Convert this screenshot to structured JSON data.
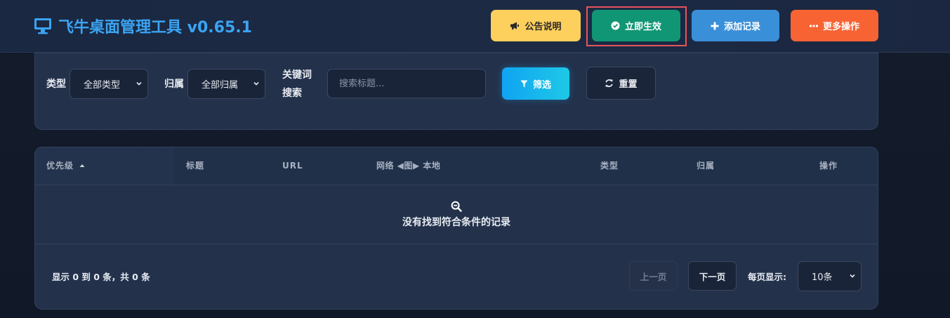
{
  "header": {
    "title": "飞牛桌面管理工具 v0.65.1",
    "buttons": {
      "notice": "公告说明",
      "apply": "立即生效",
      "add": "添加记录",
      "more": "更多操作"
    }
  },
  "filters": {
    "type_label": "类型",
    "type_value": "全部类型",
    "owner_label": "归属",
    "owner_value": "全部归属",
    "keyword_label_line1": "关键词",
    "keyword_label_line2": "搜索",
    "search_placeholder": "搜索标题...",
    "search_value": "",
    "filter_button": "筛选",
    "reset_button": "重置"
  },
  "table": {
    "columns": {
      "priority": "优先级",
      "title": "标题",
      "url": "URL",
      "network": "网络 ◀图▶ 本地",
      "type": "类型",
      "owner": "归属",
      "actions": "操作"
    },
    "sort_indicator": "up",
    "empty_message": "没有找到符合条件的记录"
  },
  "pagination": {
    "summary": "显示 0 到 0 条，共 0 条",
    "prev": "上一页",
    "next": "下一页",
    "per_page_label": "每页显示:",
    "per_page_value": "10条"
  },
  "colors": {
    "notice": "#fdcf5c",
    "apply": "#119675",
    "add": "#3a8fd9",
    "more": "#f76333",
    "title": "#3ba4f2",
    "highlight": "#e5555b"
  },
  "icons": {
    "title": "monitor-icon",
    "notice": "megaphone-icon",
    "apply": "check-circle-icon",
    "add": "plus-icon",
    "more": "ellipsis-icon",
    "filter": "funnel-icon",
    "reset": "refresh-icon",
    "empty": "search-minus-icon"
  }
}
